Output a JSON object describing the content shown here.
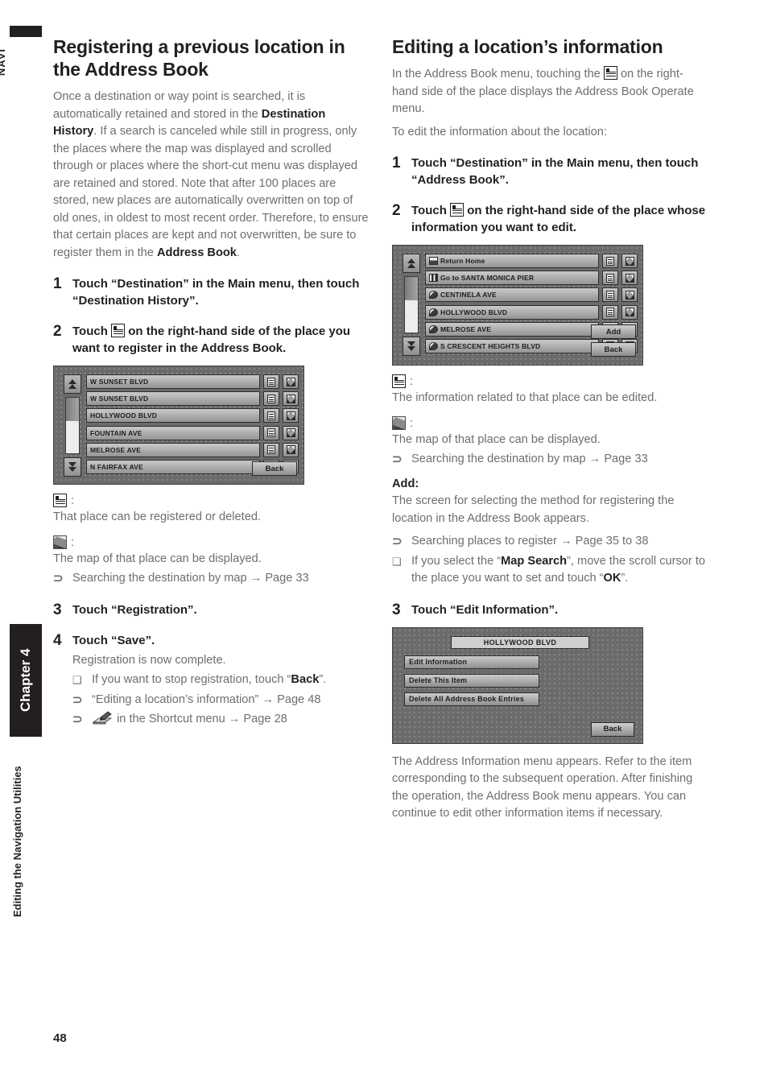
{
  "sidebar": {
    "navi_label": "NAVI",
    "chapter_label": "Chapter 4",
    "section_label": "Editing the Navigation Utilities",
    "page_number": "48"
  },
  "left_column": {
    "heading": "Registering a previous location in the Address Book",
    "intro_part1": "Once a destination or way point is searched, it is automatically retained and stored in the ",
    "intro_bold1": "Destination History",
    "intro_part2": ". If a search is canceled while still in progress, only the places where the map was displayed and scrolled through or places where the short-cut menu was displayed are retained and stored. Note that after 100 places are stored, new places are automatically overwritten on top of old ones, in oldest to most recent order. Therefore, to ensure that certain places are kept and not overwritten, be sure to register them in the ",
    "intro_bold2": "Address Book",
    "intro_part3": ".",
    "step1_num": "1",
    "step1_text": "Touch “Destination” in the Main menu, then touch “Destination History”.",
    "step2_num": "2",
    "step2_text_before": "Touch",
    "step2_text_after": "on the right-hand side of the place you want to register in the Address Book.",
    "screenshot": {
      "rows": [
        {
          "label": "W SUNSET BLVD",
          "icon": null
        },
        {
          "label": "W SUNSET BLVD",
          "icon": null
        },
        {
          "label": "HOLLYWOOD BLVD",
          "icon": null
        },
        {
          "label": "FOUNTAIN AVE",
          "icon": null
        },
        {
          "label": "MELROSE AVE",
          "icon": null
        },
        {
          "label": "N FAIRFAX AVE",
          "icon": null
        }
      ],
      "back_button": "Back"
    },
    "def_doc_colon": ":",
    "def_doc_text": "That place can be registered or deleted.",
    "def_map_colon": ":",
    "def_map_text": "The map of that place can be displayed.",
    "ref_map_text": "Searching the destination by map → Page 33",
    "step3_num": "3",
    "step3_text": "Touch “Registration”.",
    "step4_num": "4",
    "step4_text": "Touch “Save”.",
    "step4_body": "Registration is now complete.",
    "bullet_stop_before": "If you want to stop registration, touch “",
    "bullet_stop_bold": "Back",
    "bullet_stop_after": "”.",
    "ref_editing": "“Editing a location’s information” → Page 48",
    "ref_shortcut": "in the Shortcut menu → Page 28"
  },
  "right_column": {
    "heading": "Editing a location’s information",
    "intro_before": "In the Address Book menu, touching the",
    "intro_after": "on the right-hand side of the place displays the Address Book Operate menu.",
    "intro_line2": "To edit the information about the location:",
    "step1_num": "1",
    "step1_text": "Touch “Destination” in the Main menu, then touch “Address Book”.",
    "step2_num": "2",
    "step2_text_before": "Touch",
    "step2_text_after": "on the right-hand side of the place whose information you want to edit.",
    "screenshot": {
      "rows": [
        {
          "label": "Return Home",
          "icon": "home-icon"
        },
        {
          "label": "Go to SANTA MONICA PIER",
          "icon": "flag-icon"
        },
        {
          "label": "CENTINELA AVE",
          "icon": "place-icon"
        },
        {
          "label": "HOLLYWOOD BLVD",
          "icon": "place-icon"
        },
        {
          "label": "MELROSE AVE",
          "icon": "place-icon"
        },
        {
          "label": "S CRESCENT HEIGHTS BLVD",
          "icon": "place-icon"
        }
      ],
      "add_button": "Add",
      "back_button": "Back"
    },
    "def_doc_colon": ":",
    "def_doc_text": "The information related to that place can be edited.",
    "def_map_colon": ":",
    "def_map_text": "The map of that place can be displayed.",
    "ref_map_text": "Searching the destination by map → Page 33",
    "add_label": "Add:",
    "add_text": "The screen for selecting the method for registering the location in the Address Book appears.",
    "ref_register": "Searching places to register → Page 35 to 38",
    "bullet_mapsearch_before": "If you select the “",
    "bullet_mapsearch_bold": "Map Search",
    "bullet_mapsearch_mid": "”, move the scroll cursor to the place you want to set and touch “",
    "bullet_mapsearch_bold2": "OK",
    "bullet_mapsearch_after": "”.",
    "step3_num": "3",
    "step3_text": "Touch “Edit Information”.",
    "menu_screenshot": {
      "title": "HOLLYWOOD BLVD",
      "items": [
        "Edit Information",
        "Delete This Item",
        "Delete All Address Book Entries"
      ],
      "back_button": "Back"
    },
    "final_text": "The Address Information menu appears. Refer to the item corresponding to the subsequent operation. After finishing the operation, the Address Book menu appears. You can continue to edit other information items if necessary."
  }
}
